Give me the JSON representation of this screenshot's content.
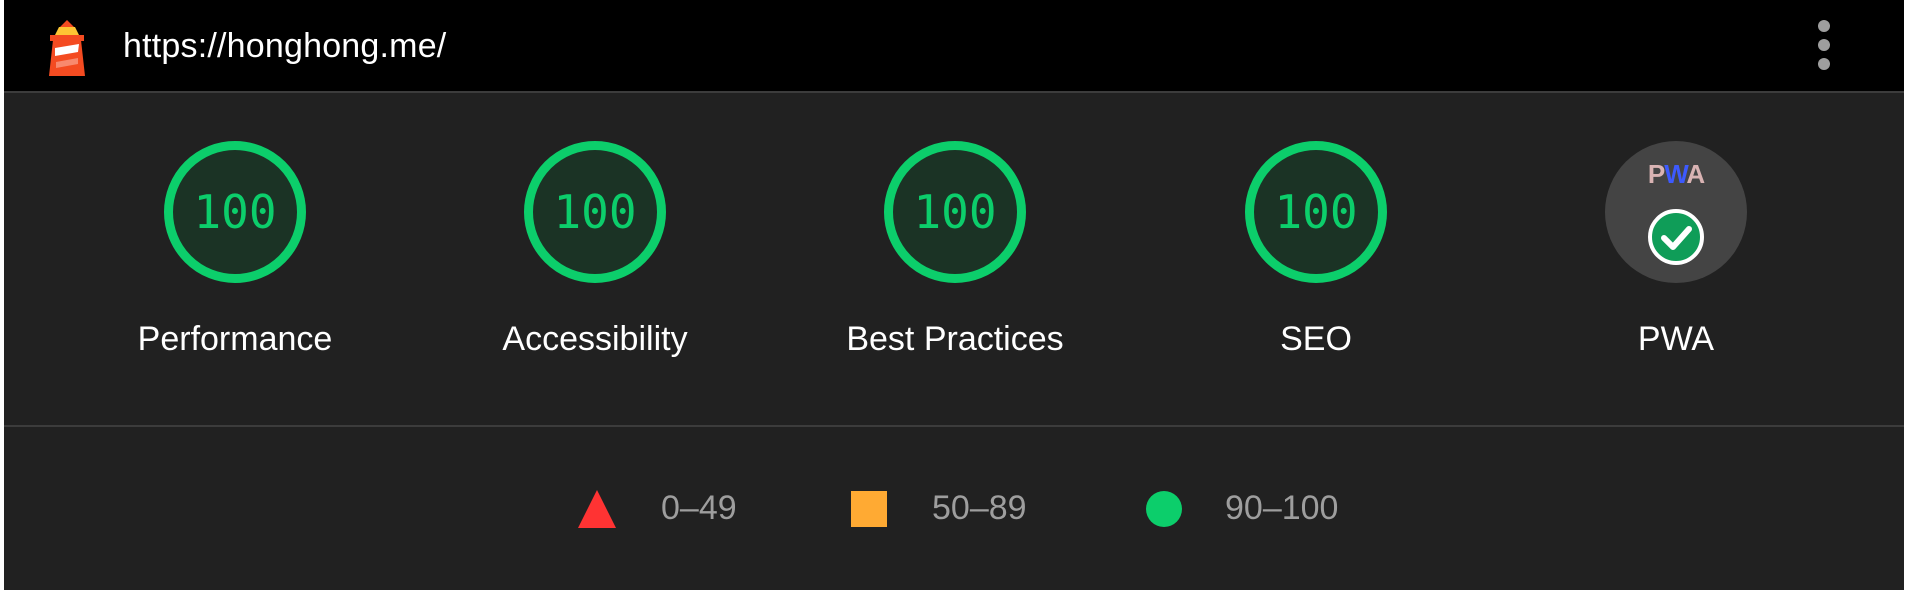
{
  "header": {
    "url": "https://honghong.me/"
  },
  "categories": [
    {
      "label": "Performance",
      "score": "100"
    },
    {
      "label": "Accessibility",
      "score": "100"
    },
    {
      "label": "Best Practices",
      "score": "100"
    },
    {
      "label": "SEO",
      "score": "100"
    }
  ],
  "pwa": {
    "label": "PWA",
    "badge_text": "PWA",
    "status": "passed"
  },
  "legend": [
    {
      "range": "0–49",
      "shape": "triangle",
      "color": "#ff3333"
    },
    {
      "range": "50–89",
      "shape": "square",
      "color": "#ffaa33"
    },
    {
      "range": "90–100",
      "shape": "circle",
      "color": "#0cce6b"
    }
  ],
  "colors": {
    "pass": "#0cce6b",
    "average": "#ffaa33",
    "fail": "#ff3333",
    "background": "#212121",
    "topbar": "#000000"
  }
}
